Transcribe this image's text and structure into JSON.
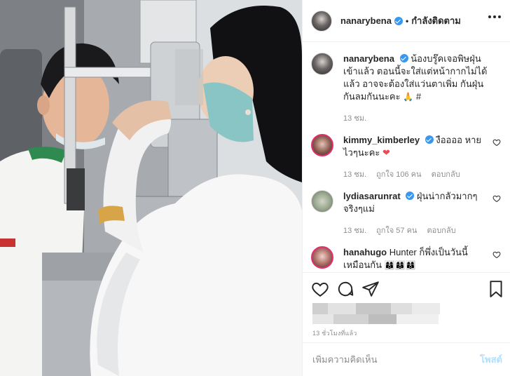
{
  "post": {
    "author": "nanarybena",
    "follow_status": "กำลังติดตาม",
    "caption": "น้องบรู๊คเจอพิษฝุ่นเข้าแล้ว ตอนนี้จะใส่แต่หน้ากากไม่ได้แล้ว อาจจะต้องใส่แว่นตาเพิ่ม กันฝุ่นกันลมกันนะคะ",
    "caption_emoji": "🙏",
    "caption_suffix": "#",
    "caption_time": "13 ชม.",
    "timestamp": "13 ชั่วโมงที่แล้ว"
  },
  "comments": [
    {
      "user": "kimmy_kimberley",
      "text": "งืออออ หาย ไวๆนะคะ",
      "emoji": "❤",
      "time": "13 ชม.",
      "likes": "ถูกใจ 106 คน",
      "reply": "ตอบกลับ"
    },
    {
      "user": "lydiasarunrat",
      "text": "ฝุ่นน่ากลัวมากๆ จริงๆแม่",
      "time": "13 ชม.",
      "likes": "ถูกใจ 57 คน",
      "reply": "ตอบกลับ"
    },
    {
      "user": "hanahugo",
      "text": "Hunter ก็พึ่งเป็นวันนี้ เหมือนกัน",
      "emoji": "👩‍👩‍👦👩‍👩‍👦👩‍👩‍👦"
    }
  ],
  "add_comment": {
    "placeholder": "เพิ่มความคิดเห็น",
    "post_label": "โพสต์"
  },
  "colors": {
    "verified": "#3897f0",
    "post_button": "#b2dffc",
    "heart": "#ed4956",
    "story_ring": "#e1306c"
  },
  "icons": [
    "more-icon",
    "verified-icon",
    "heart-icon",
    "comment-icon",
    "share-icon",
    "bookmark-icon"
  ]
}
